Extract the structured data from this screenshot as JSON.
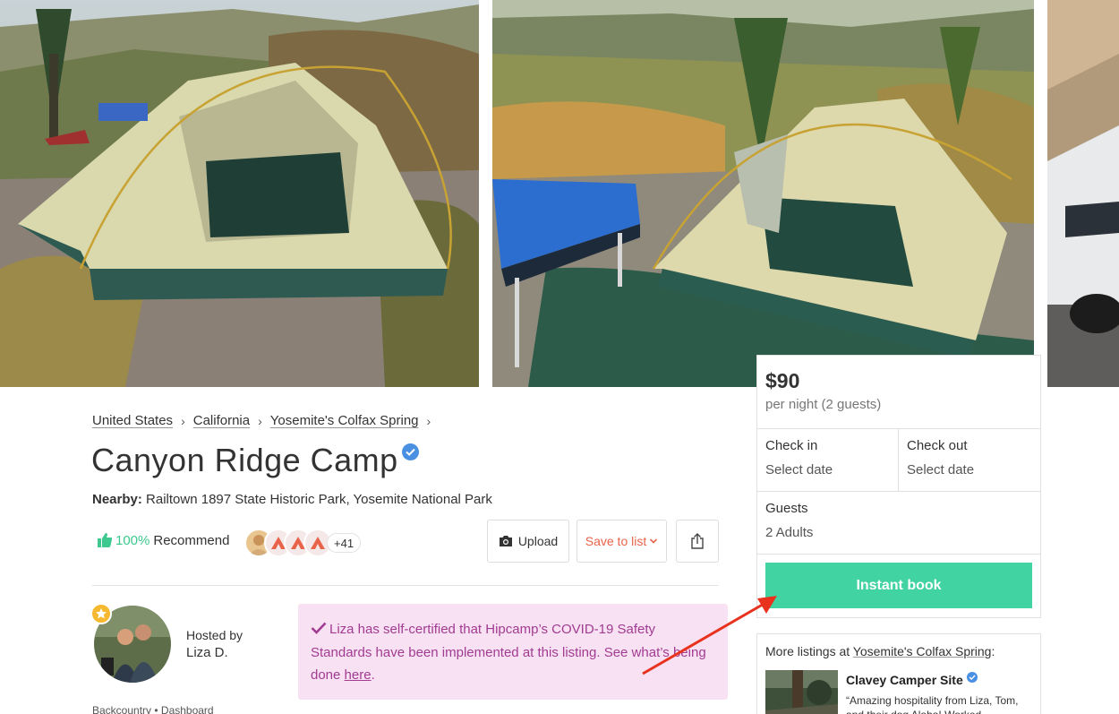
{
  "breadcrumb": {
    "items": [
      "United States",
      "California",
      "Yosemite's Colfax Spring"
    ],
    "separator": "›"
  },
  "listing": {
    "title": "Canyon Ridge Camp",
    "nearby_label": "Nearby:",
    "nearby_value": "Railtown 1897 State Historic Park, Yosemite National Park"
  },
  "recommend": {
    "percent": "100%",
    "label": "Recommend",
    "more_count": "+41"
  },
  "actions": {
    "upload_label": "Upload",
    "save_label": "Save to list"
  },
  "host": {
    "hosted_by_label": "Hosted by",
    "name": "Liza D."
  },
  "covid": {
    "text_before_link": "Liza has self-certified that Hipcamp’s COVID-19 Safety Standards have been implemented at this listing. See what’s being done ",
    "link_text": "here",
    "text_after_link": "."
  },
  "footer_crumb": "Backcountry • Dashboard",
  "booking": {
    "price": "$90",
    "per_night": "per night (2 guests)",
    "check_in_label": "Check in",
    "check_in_value": "Select date",
    "check_out_label": "Check out",
    "check_out_value": "Select date",
    "guests_label": "Guests",
    "guests_value": "2 Adults",
    "instant_book_label": "Instant book"
  },
  "more_listings": {
    "title_prefix": "More listings at ",
    "title_link": "Yosemite's Colfax Spring",
    "title_suffix": ":",
    "listing_name": "Clavey Camper Site",
    "listing_quote": "“Amazing hospitality from Liza, Tom, and their dog Aloha! Worked..."
  },
  "colors": {
    "accent_green": "#41d3a2",
    "recommend_green": "#3cc88e",
    "save_coral": "#e8634a",
    "covid_bg": "#f7e1f2",
    "covid_text": "#a23b92",
    "verified_blue": "#4a90e2",
    "annotation_red": "#e8321e"
  },
  "icons": [
    "verified-badge-icon",
    "thumbs-up-icon",
    "camera-icon",
    "chevron-down-icon",
    "share-icon",
    "checkmark-icon",
    "star-badge-icon"
  ]
}
